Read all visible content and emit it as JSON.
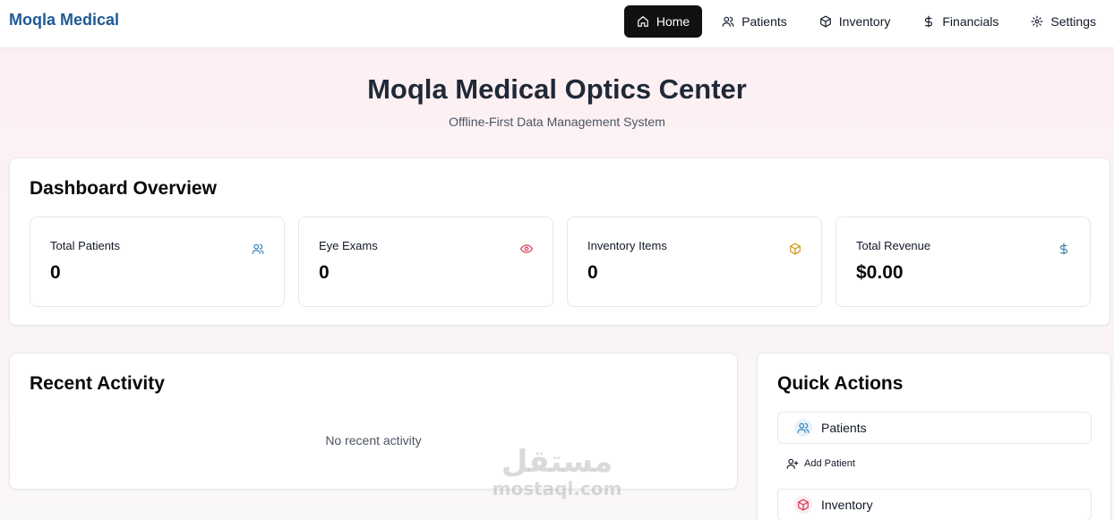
{
  "brand": "Moqla Medical",
  "nav": {
    "items": [
      {
        "label": "Home",
        "icon": "home-icon",
        "active": true
      },
      {
        "label": "Patients",
        "icon": "users-icon"
      },
      {
        "label": "Inventory",
        "icon": "box-icon"
      },
      {
        "label": "Financials",
        "icon": "dollar-icon"
      },
      {
        "label": "Settings",
        "icon": "gear-icon"
      }
    ]
  },
  "hero": {
    "title": "Moqla Medical Optics Center",
    "subtitle": "Offline-First Data Management System"
  },
  "overview": {
    "title": "Dashboard Overview",
    "stats": [
      {
        "label": "Total Patients",
        "value": "0",
        "icon": "users-icon",
        "color": "#2d7fb8"
      },
      {
        "label": "Eye Exams",
        "value": "0",
        "icon": "eye-icon",
        "color": "#d6334f"
      },
      {
        "label": "Inventory Items",
        "value": "0",
        "icon": "box-icon",
        "color": "#d1930d"
      },
      {
        "label": "Total Revenue",
        "value": "$0.00",
        "icon": "dollar-icon",
        "color": "#3d7ea6"
      }
    ]
  },
  "recent": {
    "title": "Recent Activity",
    "empty": "No recent activity"
  },
  "quick": {
    "title": "Quick Actions",
    "patients_label": "Patients",
    "add_patient_label": "Add Patient",
    "inventory_label": "Inventory"
  },
  "watermark": {
    "arabic": "مستقل",
    "latin": "mostaql.com"
  }
}
